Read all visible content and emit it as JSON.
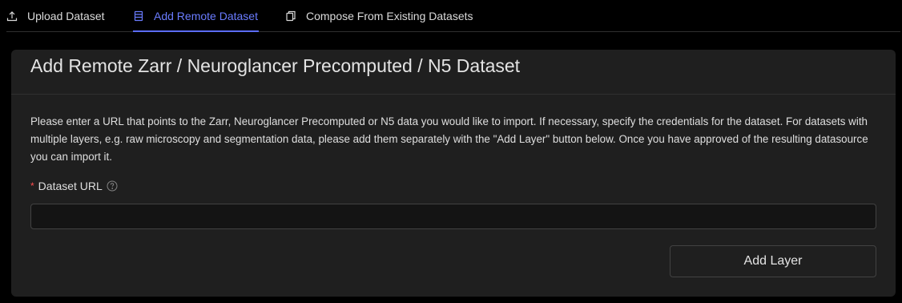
{
  "tabs": [
    {
      "label": "Upload Dataset",
      "icon": "upload-icon",
      "active": false
    },
    {
      "label": "Add Remote Dataset",
      "icon": "database-icon",
      "active": true
    },
    {
      "label": "Compose From Existing Datasets",
      "icon": "copy-icon",
      "active": false
    }
  ],
  "card": {
    "title": "Add Remote Zarr / Neuroglancer Precomputed / N5 Dataset",
    "description": "Please enter a URL that points to the Zarr, Neuroglancer Precomputed or N5 data you would like to import. If necessary, specify the credentials for the dataset. For datasets with multiple layers, e.g. raw microscopy and segmentation data, please add them separately with the \"Add Layer\" button below. Once you have approved of the resulting datasource you can import it.",
    "field": {
      "required_mark": "*",
      "label": "Dataset URL",
      "value": "",
      "help_icon": "question-circle-icon"
    },
    "add_layer_label": "Add Layer"
  },
  "colors": {
    "accent": "#6a7cff",
    "background": "#000000",
    "card": "#1f1f1f",
    "border": "#424242",
    "required": "#ff4d4f"
  }
}
